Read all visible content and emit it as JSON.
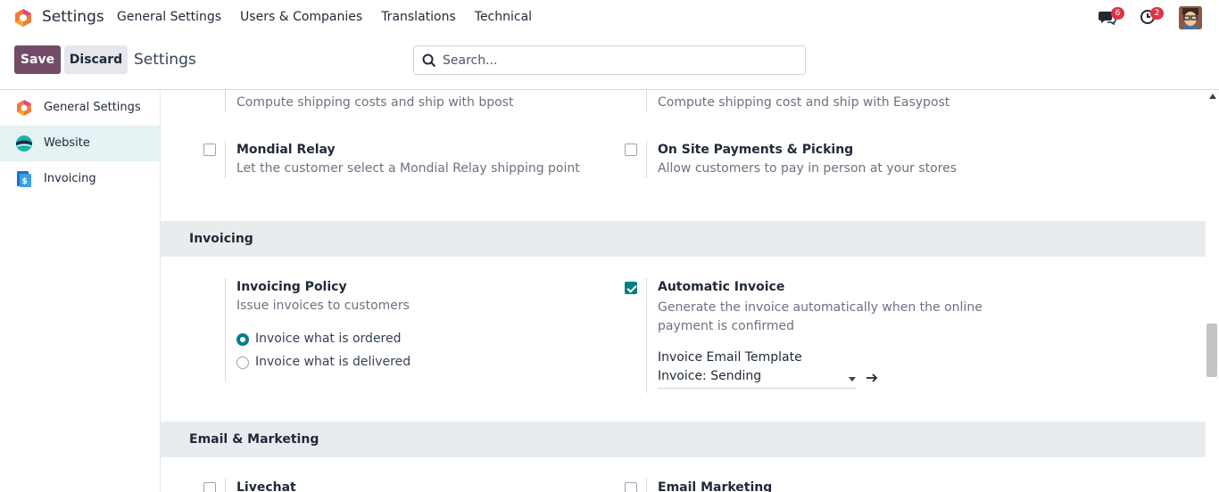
{
  "navbar": {
    "app_name": "Settings",
    "menu": [
      "General Settings",
      "Users & Companies",
      "Translations",
      "Technical"
    ],
    "chat_count": "6",
    "activity_count": "2"
  },
  "control_panel": {
    "save_label": "Save",
    "discard_label": "Discard",
    "title": "Settings",
    "search_placeholder": "Search..."
  },
  "sidebar": {
    "items": [
      {
        "label": "General Settings",
        "icon": "odoo-settings-icon",
        "active": false
      },
      {
        "label": "Website",
        "icon": "website-icon",
        "active": true
      },
      {
        "label": "Invoicing",
        "icon": "invoicing-icon",
        "active": false
      }
    ]
  },
  "shipping": {
    "bpost_desc": "Compute shipping costs and ship with bpost",
    "easypost_desc": "Compute shipping cost and ship with Easypost",
    "mondial_title": "Mondial Relay",
    "mondial_desc": "Let the customer select a Mondial Relay shipping point",
    "onsite_title": "On Site Payments & Picking",
    "onsite_desc": "Allow customers to pay in person at your stores"
  },
  "invoicing": {
    "section_title": "Invoicing",
    "policy_title": "Invoicing Policy",
    "policy_desc": "Issue invoices to customers",
    "radio_ordered": "Invoice what is ordered",
    "radio_delivered": "Invoice what is delivered",
    "auto_title": "Automatic Invoice",
    "auto_desc": "Generate the invoice automatically when the online payment is confirmed",
    "auto_checked": true,
    "template_label": "Invoice Email Template",
    "template_value": "Invoice: Sending"
  },
  "email_marketing": {
    "section_title": "Email & Marketing",
    "livechat_title": "Livechat",
    "email_marketing_title": "Email Marketing"
  },
  "colors": {
    "brand": "#714b67",
    "accent": "#017e84",
    "badge": "#dc3545"
  }
}
